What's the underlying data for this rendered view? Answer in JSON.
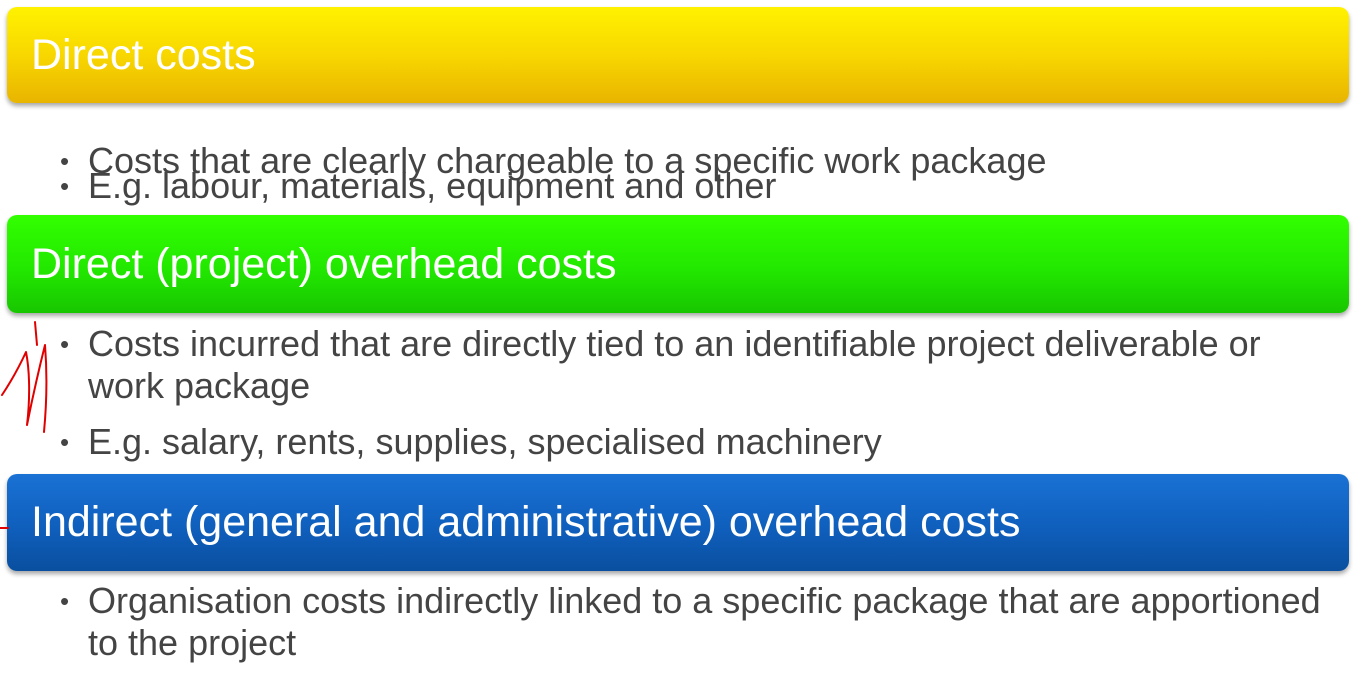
{
  "sections": [
    {
      "heading": "Direct costs",
      "bullets": [
        "Costs that are clearly chargeable to a specific work package",
        "E.g. labour, materials, equipment and other"
      ]
    },
    {
      "heading": "Direct (project) overhead costs",
      "bullets": [
        "Costs incurred that are directly tied to an identifiable project deliverable or work package",
        "E.g. salary, rents, supplies, specialised machinery"
      ]
    },
    {
      "heading": "Indirect (general and administrative) overhead costs",
      "bullets": [
        "Organisation costs indirectly linked to a specific package that are apportioned to the project"
      ]
    }
  ],
  "bullet_glyph": "•",
  "colors": {
    "yellow": "#f7d400",
    "green": "#22e800",
    "blue": "#0f5fbd",
    "text": "#444444",
    "annotation": "#e00000"
  }
}
